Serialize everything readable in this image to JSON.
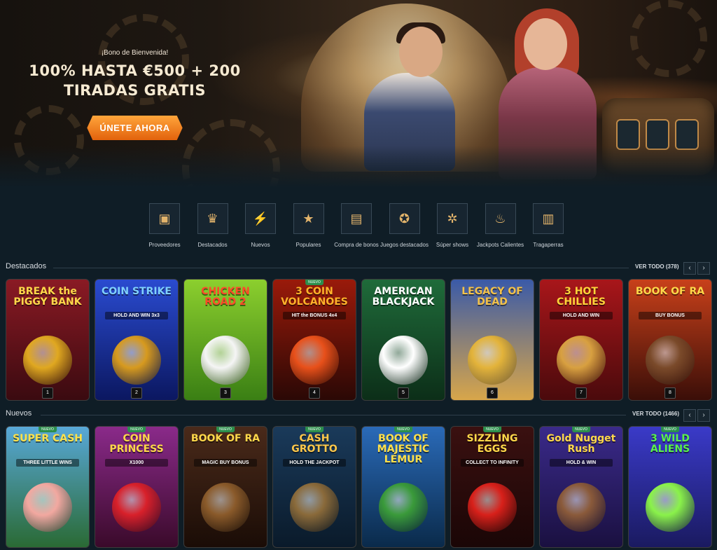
{
  "hero": {
    "small": "¡Bono de Bienvenida!",
    "line1": "100% HASTA €500 + 200",
    "line2": "TIRADAS GRATIS",
    "cta": "ÚNETE AHORA"
  },
  "categories": [
    {
      "label": "Proveedores",
      "icon": "book-icon",
      "glyph": "▣"
    },
    {
      "label": "Destacados",
      "icon": "crown-icon",
      "glyph": "♛"
    },
    {
      "label": "Nuevos",
      "icon": "lightning-icon",
      "glyph": "⚡"
    },
    {
      "label": "Populares",
      "icon": "star-icon",
      "glyph": "★"
    },
    {
      "label": "Compra de bonos",
      "icon": "chest-icon",
      "glyph": "▤"
    },
    {
      "label": "Juegos destacados",
      "icon": "chip-icon",
      "glyph": "✪"
    },
    {
      "label": "Súper shows",
      "icon": "wheel-icon",
      "glyph": "✲"
    },
    {
      "label": "Jackpots Calientes",
      "icon": "flame-icon",
      "glyph": "♨"
    },
    {
      "label": "Tragaperras",
      "icon": "slot-icon",
      "glyph": "▥"
    }
  ],
  "featured": {
    "title": "Destacados",
    "view_all": "VER TODO (378)",
    "prev": "‹",
    "next": "›",
    "games": [
      {
        "title": "BREAK the PIGGY BANK",
        "sub": "",
        "rank": "1",
        "bg1": "#8a1a24",
        "bg2": "#3a0a10",
        "color": "#ffd84a",
        "art": "#e0a820",
        "new": ""
      },
      {
        "title": "COIN STRIKE",
        "sub": "HOLD AND WIN 3x3",
        "rank": "2",
        "bg1": "#2a4bd0",
        "bg2": "#0b1760",
        "color": "#7fd0ff",
        "art": "#d79a1e",
        "new": ""
      },
      {
        "title": "CHICKEN ROAD 2",
        "sub": "",
        "rank": "3",
        "bg1": "#8ccf2e",
        "bg2": "#3a7f14",
        "color": "#ff4a2a",
        "art": "#f5f5f5",
        "new": ""
      },
      {
        "title": "3 COIN VOLCANOES",
        "sub": "HIT the BONUS 4x4",
        "rank": "4",
        "bg1": "#9a1a0a",
        "bg2": "#2a0805",
        "color": "#ffb22a",
        "art": "#e8501a",
        "new": "NUEVO"
      },
      {
        "title": "AMERICAN BLACKJACK",
        "sub": "",
        "rank": "5",
        "bg1": "#1f6b3a",
        "bg2": "#0c2e18",
        "color": "#ffffff",
        "art": "#ffffff",
        "new": ""
      },
      {
        "title": "LEGACY OF DEAD",
        "sub": "",
        "rank": "6",
        "bg1": "#3a5aa8",
        "bg2": "#d8a64a",
        "color": "#f3c24a",
        "art": "#e3b33a",
        "new": ""
      },
      {
        "title": "3 HOT CHILLIES",
        "sub": "HOLD AND WIN",
        "rank": "7",
        "bg1": "#a8161a",
        "bg2": "#4a0a0c",
        "color": "#ffd33a",
        "art": "#d8a040",
        "new": ""
      },
      {
        "title": "BOOK OF RA",
        "sub": "BUY BONUS",
        "rank": "8",
        "bg1": "#c8401a",
        "bg2": "#3a0e08",
        "color": "#ffd84a",
        "art": "#7a4a2a",
        "new": ""
      }
    ]
  },
  "new_games": {
    "title": "Nuevos",
    "view_all": "VER TODO (1466)",
    "prev": "‹",
    "next": "›",
    "games": [
      {
        "title": "SUPER CASH",
        "sub": "THREE LITTLE WINS",
        "bg1": "#58a8d8",
        "bg2": "#2a6a34",
        "color": "#ffe24a",
        "art": "#f2a8a0",
        "new": "NUEVO"
      },
      {
        "title": "COIN PRINCESS",
        "sub": "X1000",
        "bg1": "#8a2a8a",
        "bg2": "#3a0a2a",
        "color": "#ffd84a",
        "art": "#d8202a",
        "new": "NUEVO"
      },
      {
        "title": "BOOK OF RA",
        "sub": "MAGIC BUY BONUS",
        "bg1": "#4a2a1a",
        "bg2": "#1a0c06",
        "color": "#ffd84a",
        "art": "#8a5a2a",
        "new": "NUEVO"
      },
      {
        "title": "CASH GROTTO",
        "sub": "HOLD THE JACKPOT",
        "bg1": "#1a3a5a",
        "bg2": "#0a1a2a",
        "color": "#ffc84a",
        "art": "#8a6a3a",
        "new": "NUEVO"
      },
      {
        "title": "BOOK OF MAJESTIC LEMUR",
        "sub": "",
        "bg1": "#2a6ab8",
        "bg2": "#0a2a4a",
        "color": "#ffe04a",
        "art": "#3a9a3a",
        "new": "NUEVO"
      },
      {
        "title": "SIZZLING EGGS",
        "sub": "COLLECT TO INFINITY",
        "bg1": "#3a1010",
        "bg2": "#1a0606",
        "color": "#ffd84a",
        "art": "#d8201a",
        "new": "NUEVO"
      },
      {
        "title": "Gold Nugget Rush",
        "sub": "HOLD & WIN",
        "bg1": "#3a2a8a",
        "bg2": "#1a1040",
        "color": "#ffd84a",
        "art": "#8a5a3a",
        "new": "NUEVO"
      },
      {
        "title": "3 WILD ALIENS",
        "sub": "",
        "bg1": "#3a3ac8",
        "bg2": "#1a1a60",
        "color": "#5af24a",
        "art": "#8af24a",
        "new": "NUEVO"
      }
    ]
  }
}
